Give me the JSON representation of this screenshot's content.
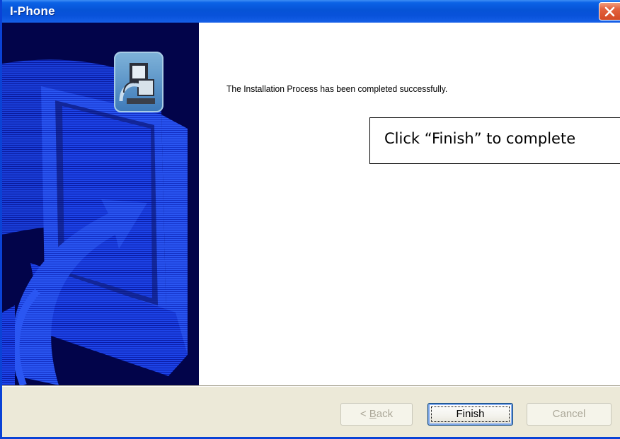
{
  "window": {
    "title": "I-Phone",
    "close_icon": "close-icon"
  },
  "sidebar": {
    "art": "installer-computer-arrow-graphic",
    "badge_icon": "computer-setup-icon",
    "colors": {
      "background": "#02044A",
      "art": "#1A3FE0"
    }
  },
  "content": {
    "message": "The Installation Process has been completed successfully.",
    "callout": "Click “Finish” to complete"
  },
  "buttons": {
    "back_prefix": "< ",
    "back_accel": "B",
    "back_rest": "ack",
    "finish": "Finish",
    "cancel": "Cancel"
  },
  "colors": {
    "titlebar": "#0653D6",
    "close": "#D44A25",
    "footer": "#ECE9D8"
  }
}
